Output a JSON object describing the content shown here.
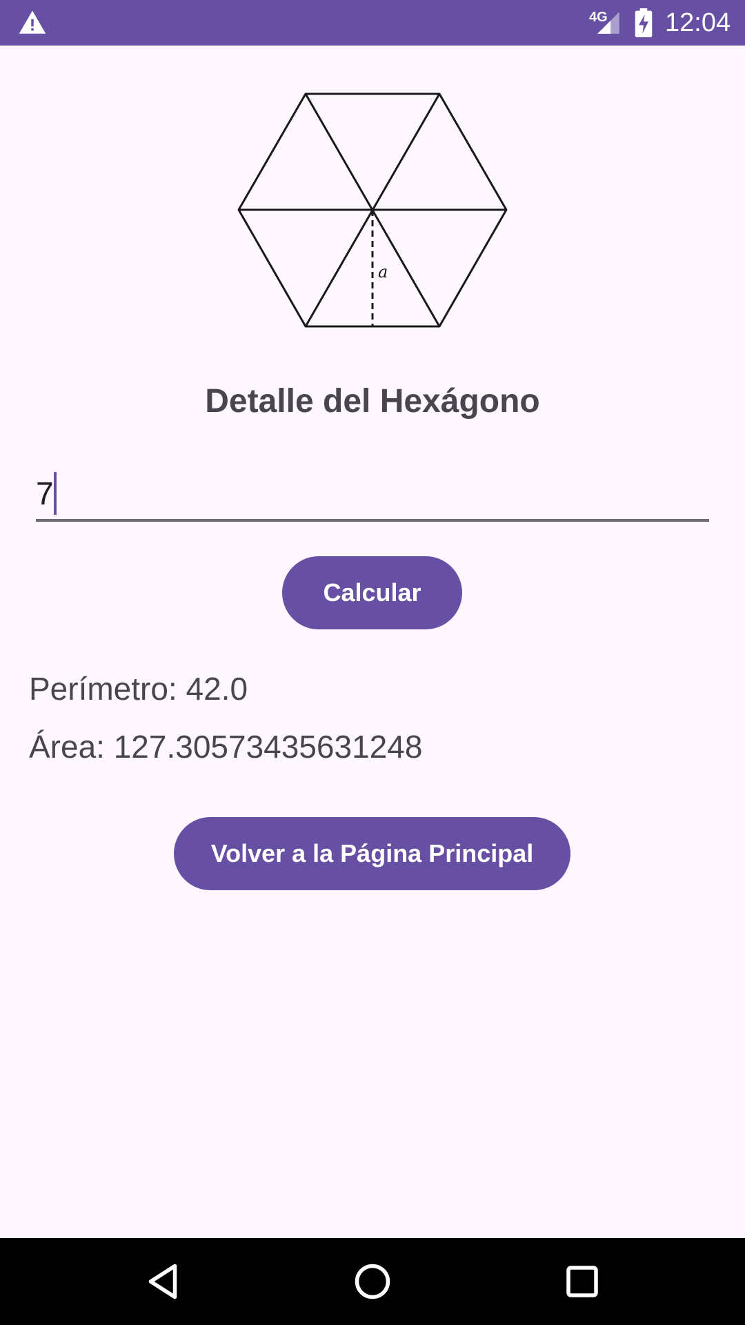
{
  "status_bar": {
    "network": "4G",
    "time": "12:04",
    "icons": [
      "warning-icon",
      "signal-icon",
      "battery-charging-icon"
    ]
  },
  "figure": {
    "label": "a"
  },
  "title": "Detalle del Hexágono",
  "input": {
    "value": "7"
  },
  "buttons": {
    "calculate": "Calcular",
    "back": "Volver a la Página Principal"
  },
  "results": {
    "perimeter": "Perímetro: 42.0",
    "area": "Área: 127.30573435631248"
  },
  "nav_bar": {
    "icons": [
      "back-icon",
      "home-icon",
      "recents-icon"
    ]
  },
  "colors": {
    "primary": "#6750A4",
    "background": "#FEF7FF",
    "text": "#49454F"
  }
}
